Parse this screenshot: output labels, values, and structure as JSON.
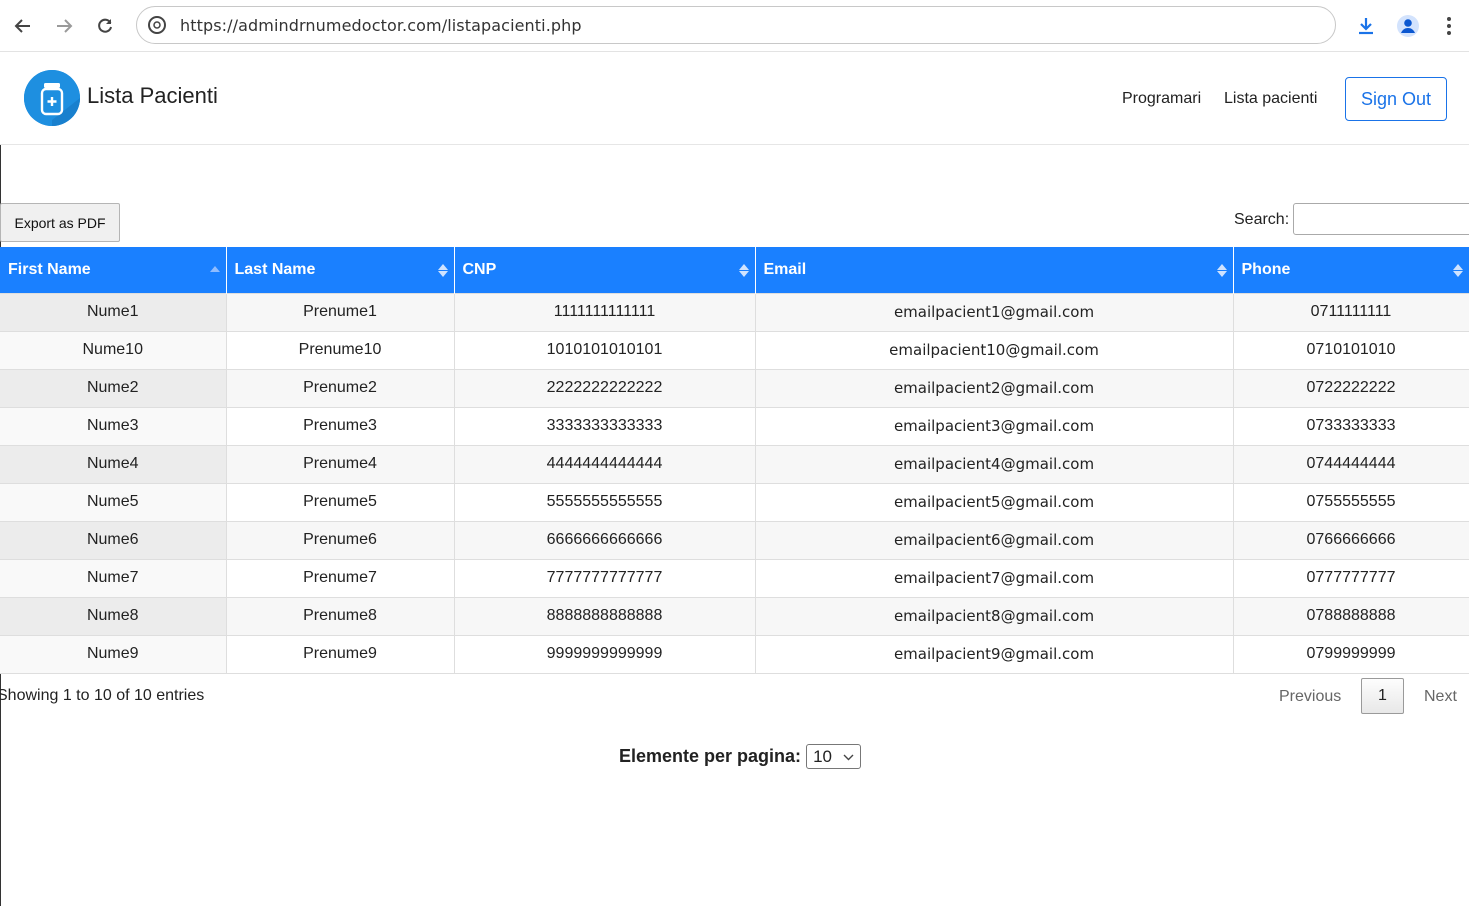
{
  "browser": {
    "url": "https://admindrnumedoctor.com/listapacienti.php"
  },
  "header": {
    "title": "Lista Pacienti",
    "nav": [
      "Programari",
      "Lista pacienti"
    ],
    "sign_out": "Sign Out"
  },
  "controls": {
    "export_label": "Export as PDF",
    "search_label": "Search:",
    "search_value": ""
  },
  "table": {
    "columns": [
      "First Name",
      "Last Name",
      "CNP",
      "Email",
      "Phone"
    ],
    "sorted_column": "First Name",
    "sort_direction": "ascending",
    "rows": [
      [
        "Nume1",
        "Prenume1",
        "1111111111111",
        "emailpacient1@gmail.com",
        "0711111111"
      ],
      [
        "Nume10",
        "Prenume10",
        "1010101010101",
        "emailpacient10@gmail.com",
        "0710101010"
      ],
      [
        "Nume2",
        "Prenume2",
        "2222222222222",
        "emailpacient2@gmail.com",
        "0722222222"
      ],
      [
        "Nume3",
        "Prenume3",
        "3333333333333",
        "emailpacient3@gmail.com",
        "0733333333"
      ],
      [
        "Nume4",
        "Prenume4",
        "4444444444444",
        "emailpacient4@gmail.com",
        "0744444444"
      ],
      [
        "Nume5",
        "Prenume5",
        "5555555555555",
        "emailpacient5@gmail.com",
        "0755555555"
      ],
      [
        "Nume6",
        "Prenume6",
        "6666666666666",
        "emailpacient6@gmail.com",
        "0766666666"
      ],
      [
        "Nume7",
        "Prenume7",
        "7777777777777",
        "emailpacient7@gmail.com",
        "0777777777"
      ],
      [
        "Nume8",
        "Prenume8",
        "8888888888888",
        "emailpacient8@gmail.com",
        "0788888888"
      ],
      [
        "Nume9",
        "Prenume9",
        "9999999999999",
        "emailpacient9@gmail.com",
        "0799999999"
      ]
    ]
  },
  "footer": {
    "info": "Showing 1 to 10 of 10 entries",
    "previous": "Previous",
    "current_page": "1",
    "next": "Next",
    "per_page_label": "Elemente per pagina:",
    "per_page_value": "10"
  },
  "colors": {
    "header_blue": "#1a80ff",
    "link_blue": "#1a73e8",
    "logo_blue": "#1e8fe0"
  }
}
